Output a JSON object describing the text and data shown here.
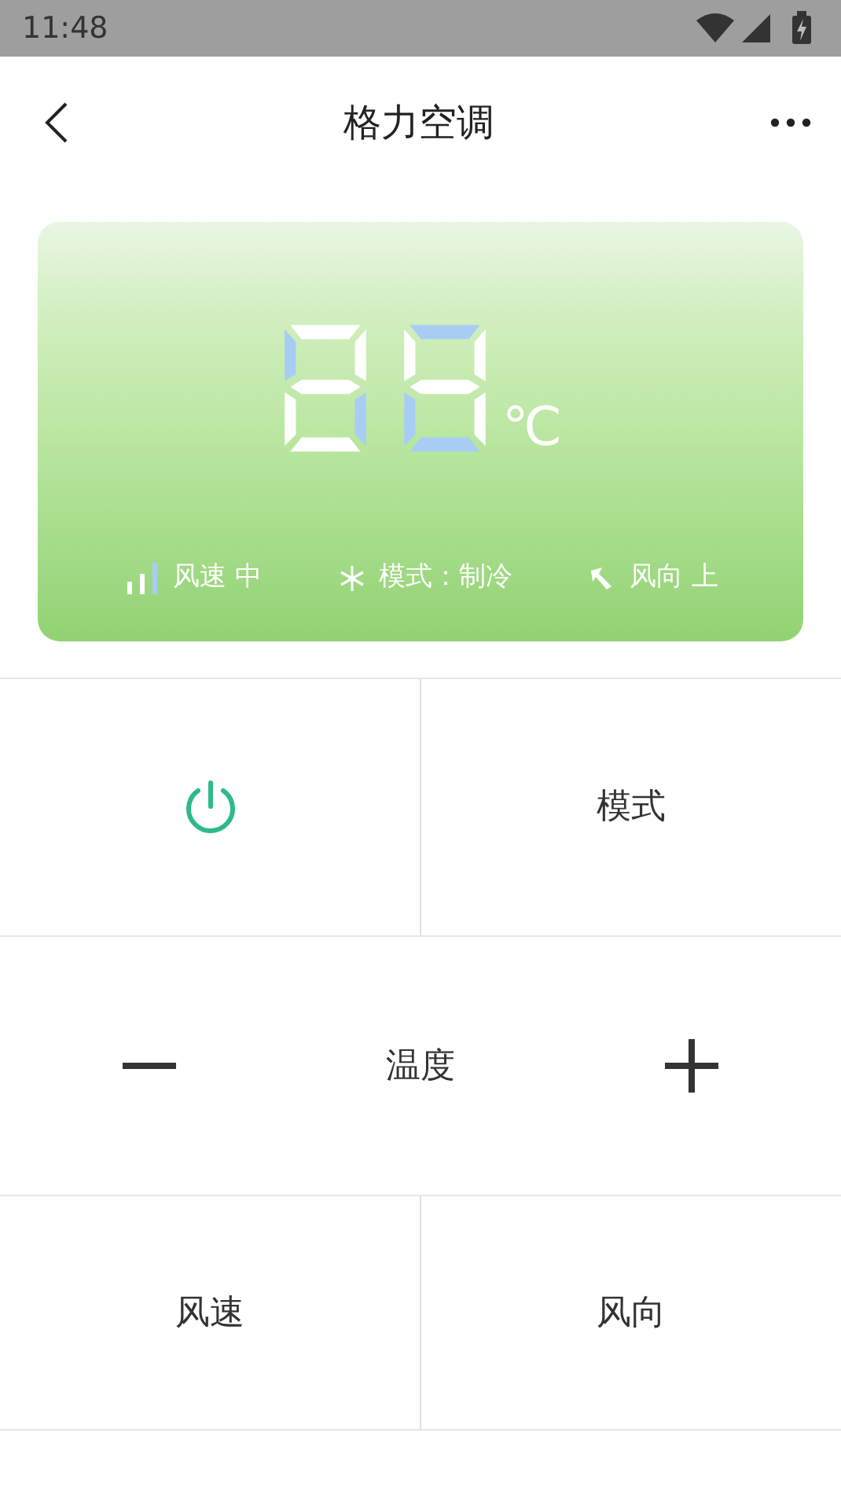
{
  "status_bar": {
    "time": "11:48"
  },
  "header": {
    "title": "格力空调"
  },
  "display": {
    "digits": [
      {
        "segments": {
          "a": true,
          "b": true,
          "c": false,
          "d": true,
          "e": true,
          "f": false,
          "g": true
        }
      },
      {
        "segments": {
          "a": false,
          "b": true,
          "c": true,
          "d": false,
          "e": false,
          "f": true,
          "g": true
        }
      }
    ],
    "unit": "℃",
    "info": [
      {
        "kind": "speed",
        "text": "风速 中"
      },
      {
        "kind": "mode",
        "text": "模式：制冷"
      },
      {
        "kind": "direction",
        "text": "风向 上"
      }
    ]
  },
  "controls": {
    "power": {
      "on": true
    },
    "mode": "模式",
    "temperature": {
      "label": "温度"
    },
    "speed": "风速",
    "direction": "风向"
  }
}
